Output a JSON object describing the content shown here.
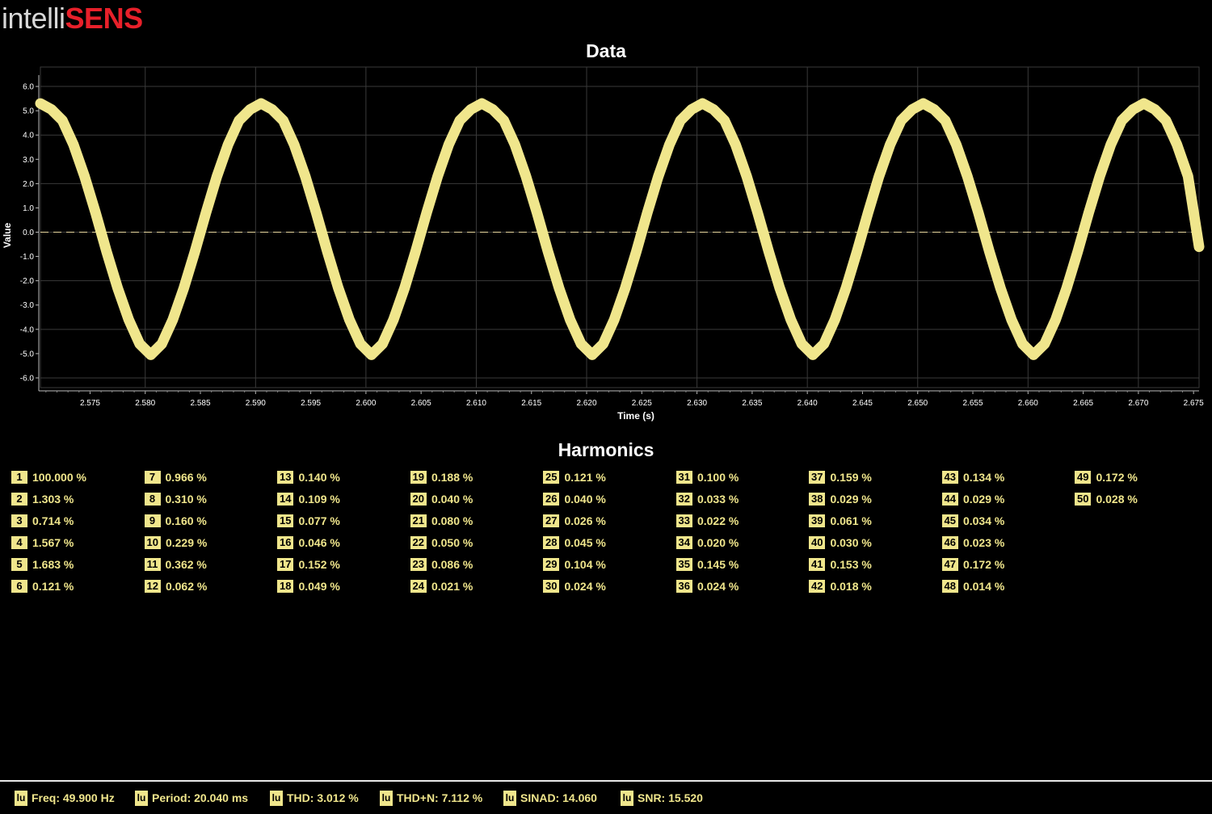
{
  "brand": {
    "part1": "intelli",
    "part2": "SENS"
  },
  "chart_data": {
    "type": "line",
    "title": "Data",
    "xlabel": "Time (s)",
    "ylabel": "Value",
    "xlim": [
      2.5705,
      2.6755
    ],
    "ylim": [
      -6.4,
      6.8
    ],
    "xticks": [
      "2.575",
      "2.580",
      "2.585",
      "2.590",
      "2.595",
      "2.600",
      "2.605",
      "2.610",
      "2.615",
      "2.620",
      "2.625",
      "2.630",
      "2.635",
      "2.640",
      "2.645",
      "2.650",
      "2.655",
      "2.660",
      "2.665",
      "2.670",
      "2.675"
    ],
    "yticks": [
      "6.0",
      "5.0",
      "4.0",
      "3.0",
      "2.0",
      "1.0",
      "0.0",
      "-1.0",
      "-2.0",
      "-3.0",
      "-4.0",
      "-5.0",
      "-6.0"
    ],
    "grid": true,
    "reference_line": 0.0,
    "series": [
      {
        "color": "#f0e68c",
        "x": [
          2.5705,
          2.5715,
          2.5725,
          2.5735,
          2.5745,
          2.5755,
          2.5765,
          2.5775,
          2.5785,
          2.5795,
          2.5805,
          2.5815,
          2.5825,
          2.5835,
          2.5845,
          2.5855,
          2.5865,
          2.5875,
          2.5885,
          2.5895,
          2.5905,
          2.5915,
          2.5925,
          2.5935,
          2.5945,
          2.5955,
          2.5965,
          2.5975,
          2.5985,
          2.5995,
          2.6005,
          2.6015,
          2.6025,
          2.6035,
          2.6045,
          2.6055,
          2.6065,
          2.6075,
          2.6085,
          2.6095,
          2.6105,
          2.6115,
          2.6125,
          2.6135,
          2.6145,
          2.6155,
          2.6165,
          2.6175,
          2.6185,
          2.6195,
          2.6205,
          2.6215,
          2.6225,
          2.6235,
          2.6245,
          2.6255,
          2.6265,
          2.6275,
          2.6285,
          2.6295,
          2.6305,
          2.6315,
          2.6325,
          2.6335,
          2.6345,
          2.6355,
          2.6365,
          2.6375,
          2.6385,
          2.6395,
          2.6405,
          2.6415,
          2.6425,
          2.6435,
          2.6445,
          2.6455,
          2.6465,
          2.6475,
          2.6485,
          2.6495,
          2.6505,
          2.6515,
          2.6525,
          2.6535,
          2.6545,
          2.6555,
          2.6565,
          2.6575,
          2.6585,
          2.6595,
          2.6605,
          2.6615,
          2.6625,
          2.6635,
          2.6645,
          2.6655,
          2.6665,
          2.6675,
          2.6685,
          2.6695,
          2.6705,
          2.6715,
          2.6725,
          2.6735,
          2.6745,
          2.6755
        ],
        "y": [
          5.3,
          5.05,
          4.6,
          3.6,
          2.3,
          0.8,
          -0.8,
          -2.3,
          -3.6,
          -4.6,
          -5.05,
          -4.6,
          -3.6,
          -2.3,
          -0.8,
          0.8,
          2.3,
          3.6,
          4.6,
          5.05,
          5.3,
          5.05,
          4.6,
          3.6,
          2.3,
          0.8,
          -0.8,
          -2.3,
          -3.6,
          -4.6,
          -5.05,
          -4.6,
          -3.6,
          -2.3,
          -0.8,
          0.8,
          2.3,
          3.6,
          4.6,
          5.05,
          5.3,
          5.05,
          4.6,
          3.6,
          2.3,
          0.8,
          -0.8,
          -2.3,
          -3.6,
          -4.6,
          -5.05,
          -4.6,
          -3.6,
          -2.3,
          -0.8,
          0.8,
          2.3,
          3.6,
          4.6,
          5.05,
          5.3,
          5.05,
          4.6,
          3.6,
          2.3,
          0.8,
          -0.8,
          -2.3,
          -3.6,
          -4.6,
          -5.05,
          -4.6,
          -3.6,
          -2.3,
          -0.8,
          0.8,
          2.3,
          3.6,
          4.6,
          5.05,
          5.3,
          5.05,
          4.6,
          3.6,
          2.3,
          0.8,
          -0.8,
          -2.3,
          -3.6,
          -4.6,
          -5.05,
          -4.6,
          -3.6,
          -2.3,
          -0.8,
          0.8,
          2.3,
          3.6,
          4.6,
          5.05,
          5.3,
          5.05,
          4.6,
          3.6,
          2.3,
          -0.6
        ]
      }
    ]
  },
  "harmonics": {
    "title": "Harmonics",
    "items": [
      {
        "n": "1",
        "value": "100.000 %"
      },
      {
        "n": "2",
        "value": "1.303 %"
      },
      {
        "n": "3",
        "value": "0.714 %"
      },
      {
        "n": "4",
        "value": "1.567 %"
      },
      {
        "n": "5",
        "value": "1.683 %"
      },
      {
        "n": "6",
        "value": "0.121 %"
      },
      {
        "n": "7",
        "value": "0.966 %"
      },
      {
        "n": "8",
        "value": "0.310 %"
      },
      {
        "n": "9",
        "value": "0.160 %"
      },
      {
        "n": "10",
        "value": "0.229 %"
      },
      {
        "n": "11",
        "value": "0.362 %"
      },
      {
        "n": "12",
        "value": "0.062 %"
      },
      {
        "n": "13",
        "value": "0.140 %"
      },
      {
        "n": "14",
        "value": "0.109 %"
      },
      {
        "n": "15",
        "value": "0.077 %"
      },
      {
        "n": "16",
        "value": "0.046 %"
      },
      {
        "n": "17",
        "value": "0.152 %"
      },
      {
        "n": "18",
        "value": "0.049 %"
      },
      {
        "n": "19",
        "value": "0.188 %"
      },
      {
        "n": "20",
        "value": "0.040 %"
      },
      {
        "n": "21",
        "value": "0.080 %"
      },
      {
        "n": "22",
        "value": "0.050 %"
      },
      {
        "n": "23",
        "value": "0.086 %"
      },
      {
        "n": "24",
        "value": "0.021 %"
      },
      {
        "n": "25",
        "value": "0.121 %"
      },
      {
        "n": "26",
        "value": "0.040 %"
      },
      {
        "n": "27",
        "value": "0.026 %"
      },
      {
        "n": "28",
        "value": "0.045 %"
      },
      {
        "n": "29",
        "value": "0.104 %"
      },
      {
        "n": "30",
        "value": "0.024 %"
      },
      {
        "n": "31",
        "value": "0.100 %"
      },
      {
        "n": "32",
        "value": "0.033 %"
      },
      {
        "n": "33",
        "value": "0.022 %"
      },
      {
        "n": "34",
        "value": "0.020 %"
      },
      {
        "n": "35",
        "value": "0.145 %"
      },
      {
        "n": "36",
        "value": "0.024 %"
      },
      {
        "n": "37",
        "value": "0.159 %"
      },
      {
        "n": "38",
        "value": "0.029 %"
      },
      {
        "n": "39",
        "value": "0.061 %"
      },
      {
        "n": "40",
        "value": "0.030 %"
      },
      {
        "n": "41",
        "value": "0.153 %"
      },
      {
        "n": "42",
        "value": "0.018 %"
      },
      {
        "n": "43",
        "value": "0.134 %"
      },
      {
        "n": "44",
        "value": "0.029 %"
      },
      {
        "n": "45",
        "value": "0.034 %"
      },
      {
        "n": "46",
        "value": "0.023 %"
      },
      {
        "n": "47",
        "value": "0.172 %"
      },
      {
        "n": "48",
        "value": "0.014 %"
      },
      {
        "n": "49",
        "value": "0.172 %"
      },
      {
        "n": "50",
        "value": "0.028 %"
      }
    ]
  },
  "stats": {
    "icon_label": "lu",
    "items": [
      {
        "name": "freq",
        "text": "Freq: 49.900 Hz"
      },
      {
        "name": "period",
        "text": "Period: 20.040 ms"
      },
      {
        "name": "thd",
        "text": "THD: 3.012 %"
      },
      {
        "name": "thd-n",
        "text": "THD+N: 7.112 %"
      },
      {
        "name": "sinad",
        "text": "SINAD: 14.060"
      },
      {
        "name": "snr",
        "text": "SNR: 15.520"
      }
    ]
  }
}
